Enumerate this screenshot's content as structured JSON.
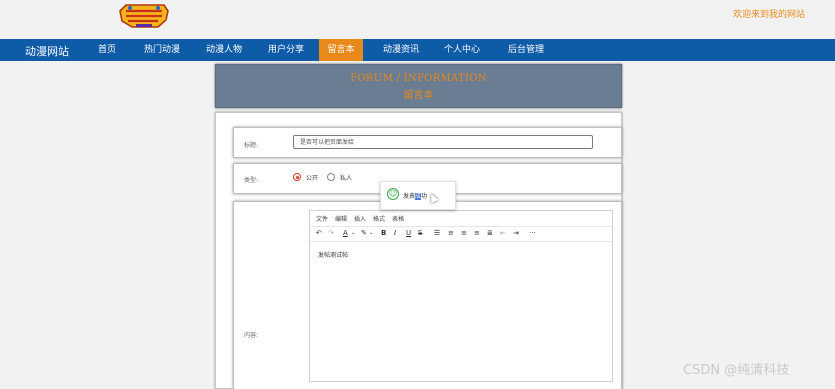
{
  "header": {
    "logo_icon": "digimon-adventure-logo",
    "welcome_text": "欢迎来到我的网站"
  },
  "nav": {
    "brand": "动漫网站",
    "items": [
      {
        "label": "首页"
      },
      {
        "label": "热门动漫"
      },
      {
        "label": "动漫人物"
      },
      {
        "label": "用户分享"
      },
      {
        "label": "留言本",
        "active": true
      },
      {
        "label": "动漫资讯"
      },
      {
        "label": "个人中心"
      },
      {
        "label": "后台管理"
      }
    ]
  },
  "banner": {
    "title_en": "FORUM / INFORMATION",
    "title_zh": "留言本"
  },
  "form": {
    "title_label": "标题:",
    "title_value": "是否可以把页面发给",
    "type_label": "类型:",
    "type_options": [
      {
        "label": "公开",
        "selected": true
      },
      {
        "label": "私人",
        "selected": false
      }
    ],
    "content_label": "内容:",
    "editor_menus": [
      "文件",
      "编辑",
      "插入",
      "格式",
      "表格"
    ],
    "editor_content": "发帖测试帖"
  },
  "toast": {
    "icon": "smile-icon",
    "text_before": "发表",
    "text_selected": "成",
    "text_after": "功"
  },
  "toolbar_icons": [
    "undo-icon",
    "redo-icon",
    "font-color-icon",
    "highlight-icon",
    "bold-icon",
    "italic-icon",
    "underline-icon",
    "strikethrough-icon",
    "align-left-icon",
    "align-center-icon",
    "align-right-icon",
    "justify-icon",
    "outdent-icon",
    "indent-icon",
    "more-icon"
  ],
  "watermark": "CSDN @纯清科技",
  "colors": {
    "nav_bg": "#0e5ba8",
    "accent": "#e8891a",
    "banner_bg": "#6b7d92"
  }
}
